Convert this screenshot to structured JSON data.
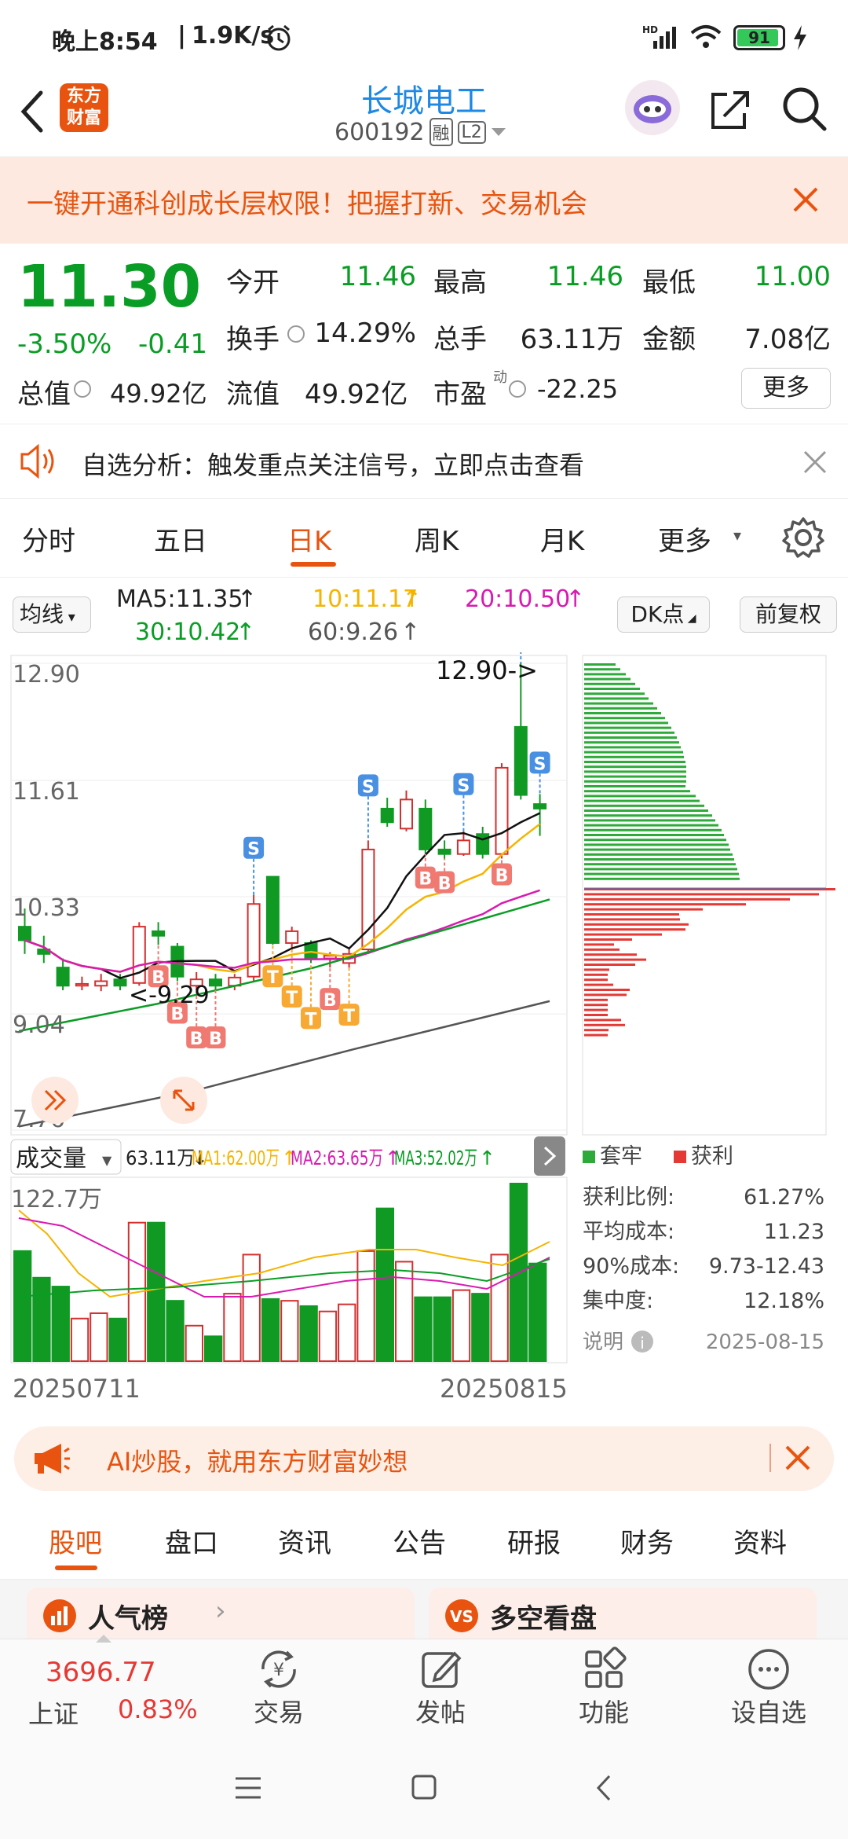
{
  "status": {
    "time": "晚上8:54",
    "speed": "1.9K/s",
    "battery": "91"
  },
  "header": {
    "logo_line1": "东方",
    "logo_line2": "财富",
    "name": "长城电工",
    "code": "600192",
    "badge1": "融",
    "badge2": "L2"
  },
  "banner": {
    "text": "一键开通科创成长层权限！把握打新、交易机会"
  },
  "quote": {
    "price": "11.30",
    "change_pct": "-3.50%",
    "change_amt": "-0.41",
    "open_label": "今开",
    "open": "11.46",
    "high_label": "最高",
    "high": "11.46",
    "low_label": "最低",
    "low": "11.00",
    "turnover_label": "换手",
    "turnover": "14.29%",
    "volume_label": "总手",
    "volume": "63.11万",
    "amount_label": "金额",
    "amount": "7.08亿",
    "mktcap_label": "总值",
    "mktcap": "49.92亿",
    "float_label": "流值",
    "float": "49.92亿",
    "pe_label": "市盈",
    "pe_sup": "动",
    "pe": "-22.25",
    "more": "更多"
  },
  "analysis": {
    "text": "自选分析：触发重点关注信号，立即点击查看"
  },
  "ktabs": {
    "items": [
      "分时",
      "五日",
      "日K",
      "周K",
      "月K",
      "更多"
    ],
    "active": 2
  },
  "ma": {
    "selector": "均线",
    "ma5": "MA5:11.35",
    "ma10": "10:11.17",
    "ma20": "20:10.50",
    "ma30": "30:10.42",
    "ma60": "60:9.26",
    "dk": "DK点",
    "fq": "前复权"
  },
  "kchart": {
    "y_labels": [
      "12.90",
      "11.61",
      "10.33",
      "9.04",
      "7.76"
    ],
    "high_marker": "12.90->",
    "low_marker": "<-9.29",
    "signal_B": "B",
    "signal_S": "S",
    "signal_T": "T"
  },
  "volume": {
    "selector": "成交量",
    "value": "63.11万",
    "ma1": "MA1:62.00万",
    "ma2": "MA2:63.65万",
    "ma3": "MA3:52.02万",
    "top_label": "122.7万",
    "date_start": "20250711",
    "date_end": "20250815"
  },
  "chip": {
    "legend_trapped": "套牢",
    "legend_profit": "获利",
    "profit_ratio_label": "获利比例:",
    "profit_ratio": "61.27%",
    "avg_cost_label": "平均成本:",
    "avg_cost": "11.23",
    "cost90_label": "90%成本:",
    "cost90": "9.73-12.43",
    "concentration_label": "集中度:",
    "concentration": "12.18%",
    "note_label": "说明",
    "date": "2025-08-15"
  },
  "ai_banner": {
    "text": "AI炒股，就用东方财富妙想"
  },
  "bottom_tabs": {
    "items": [
      "股吧",
      "盘口",
      "资讯",
      "公告",
      "研报",
      "财务",
      "资料"
    ],
    "active": 0
  },
  "cards": {
    "left": "人气榜",
    "right": "多空看盘"
  },
  "bottom_nav": {
    "index_value": "3696.77",
    "index_name": "上证",
    "index_change": "0.83%",
    "trade": "交易",
    "post": "发帖",
    "function": "功能",
    "watchlist": "设自选"
  },
  "colors": {
    "accent": "#e8540f",
    "up": "#e53935",
    "down": "#0a9d25",
    "ma10": "#f5b400",
    "ma20": "#d81bb0"
  }
}
